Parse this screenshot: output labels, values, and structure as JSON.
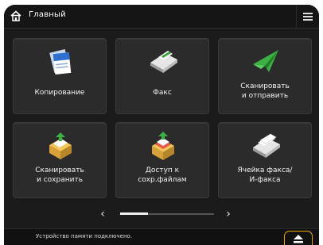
{
  "header": {
    "title": "Главный",
    "home_icon": "home-icon",
    "menu_icon": "menu-icon"
  },
  "tiles": [
    {
      "label": "Копирование",
      "icon": "copy-icon"
    },
    {
      "label": "Факс",
      "icon": "fax-icon"
    },
    {
      "label": "Сканировать\nи отправить",
      "icon": "scan-send-icon"
    },
    {
      "label": "Сканировать\nи сохранить",
      "icon": "scan-save-icon"
    },
    {
      "label": "Доступ к\nсохр.файлам",
      "icon": "stored-files-icon"
    },
    {
      "label": "Ячейка факса/\nИ-факса",
      "icon": "fax-inbox-icon"
    }
  ],
  "pager": {
    "prev": "‹",
    "next": "›",
    "progress": 0.3
  },
  "status": {
    "text": "Устройство памяти подключено.",
    "eject_icon": "eject-icon",
    "accent": "#f0a800"
  }
}
